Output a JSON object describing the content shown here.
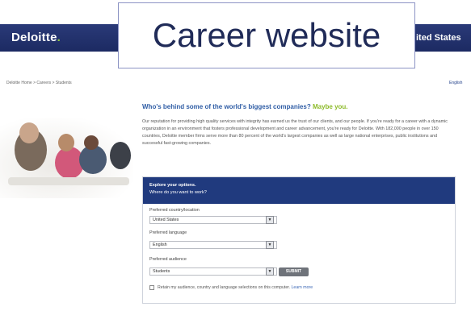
{
  "header": {
    "logo_text": "Deloitte",
    "logo_dot": ".",
    "country": "ited States",
    "overlay_title": "Career website"
  },
  "nav": {
    "breadcrumb": "Deloitte Home > Careers > Students",
    "language_link": "English"
  },
  "main": {
    "headline": "Who's behind some of the world's biggest companies?",
    "headline_accent": "Maybe you.",
    "intro": "Our reputation for providing high quality services with integrity has earned us the trust of our clients, and our people. If you're ready for a career with a dynamic organization in an environment that fosters professional development and career advancement, you're ready for Deloitte. With 182,000 people in over 150 countries, Deloitte member firms serve more than 80 percent of the world's largest companies as well as large national enterprises, public institutions and successful fast-growing companies."
  },
  "panel": {
    "title": "Explore your options.",
    "subtitle": "Where do you want to work?",
    "country_label": "Preferred country/location",
    "country_value": "United States",
    "language_label": "Preferred language",
    "language_value": "English",
    "audience_label": "Preferred audience",
    "audience_value": "Students",
    "submit_label": "SUBMIT",
    "retain_text": "Retain my audience, country and language selections on this computer.",
    "learn_more": "Learn more"
  },
  "colors": {
    "banner": "#1c2a62",
    "logo_dot": "#8dc63f",
    "headline": "#2f5da5",
    "headline_accent": "#8dbb2a",
    "panel_header": "#203a7e"
  }
}
